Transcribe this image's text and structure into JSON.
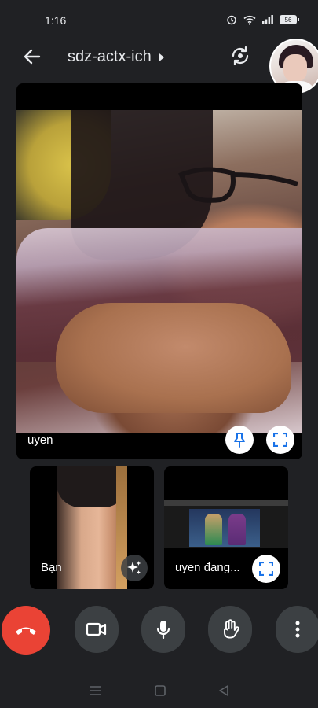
{
  "status_bar": {
    "time": "1:16",
    "battery": "56",
    "icons": [
      "alarm-icon",
      "wifi-icon",
      "signal-icon",
      "battery-icon"
    ]
  },
  "header": {
    "meeting_code": "sdz-actx-ich",
    "back_icon": "arrow-back-icon",
    "switch_camera_icon": "switch-camera-icon"
  },
  "main_tile": {
    "participant_name": "uyen",
    "pin_icon": "pin-icon",
    "fullscreen_icon": "fullscreen-icon"
  },
  "small_tiles": [
    {
      "participant_name": "Bạn",
      "action_icon": "sparkle-effects-icon"
    },
    {
      "participant_name": "uyen đang...",
      "action_icon": "fullscreen-icon"
    }
  ],
  "controls": {
    "end_call_icon": "end-call-icon",
    "camera_icon": "camera-icon",
    "mic_icon": "mic-icon",
    "raise_hand_icon": "raise-hand-icon",
    "more_icon": "more-vert-icon"
  },
  "nav_bar": {
    "icons": [
      "recents-icon",
      "home-icon",
      "back-icon"
    ]
  },
  "colors": {
    "background": "#202124",
    "end_call": "#ea4335",
    "control_button": "#3c4043",
    "text": "#e8eaed"
  }
}
